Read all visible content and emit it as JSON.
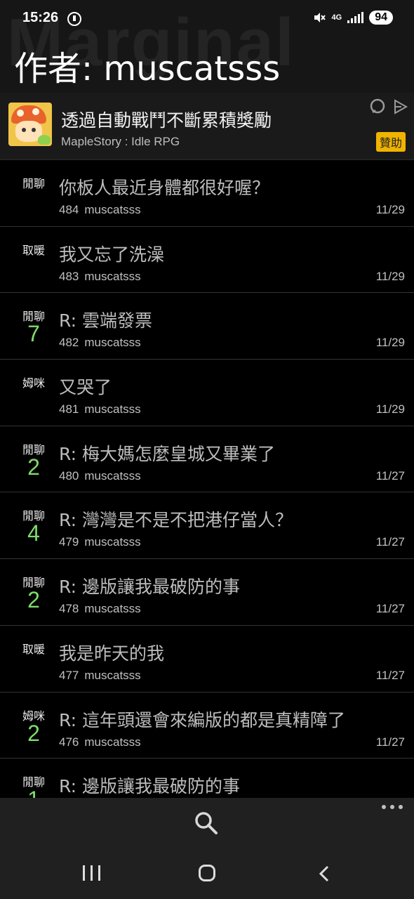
{
  "status_bar": {
    "time": "15:26",
    "network": "4G",
    "battery": "94"
  },
  "header": {
    "watermark": "Marginal",
    "title": "作者: muscatsss"
  },
  "ad": {
    "title": "透過自動戰鬥不斷累積獎勵",
    "subtitle": "MapleStory : Idle RPG",
    "badge": "贊助",
    "icons": [
      "chat-bubble-icon",
      "play-triangle-icon"
    ]
  },
  "posts": [
    {
      "category": "閒聊",
      "reply_count": "",
      "subject": "你板人最近身體都很好喔？",
      "number": "484",
      "author": "muscatsss",
      "date": "11/29"
    },
    {
      "category": "取暖",
      "reply_count": "",
      "subject": "我又忘了洗澡",
      "number": "483",
      "author": "muscatsss",
      "date": "11/29"
    },
    {
      "category": "閒聊",
      "reply_count": "7",
      "subject": "R: 雲端發票",
      "number": "482",
      "author": "muscatsss",
      "date": "11/29"
    },
    {
      "category": "姆咪",
      "reply_count": "",
      "subject": "又哭了",
      "number": "481",
      "author": "muscatsss",
      "date": "11/29"
    },
    {
      "category": "閒聊",
      "reply_count": "2",
      "subject": "R: 梅大媽怎麼皇城又畢業了",
      "number": "480",
      "author": "muscatsss",
      "date": "11/27"
    },
    {
      "category": "閒聊",
      "reply_count": "4",
      "subject": "R: 灣灣是不是不把港仔當人？",
      "number": "479",
      "author": "muscatsss",
      "date": "11/27"
    },
    {
      "category": "閒聊",
      "reply_count": "2",
      "subject": "R: 邊版讓我最破防的事",
      "number": "478",
      "author": "muscatsss",
      "date": "11/27"
    },
    {
      "category": "取暖",
      "reply_count": "",
      "subject": "我是昨天的我",
      "number": "477",
      "author": "muscatsss",
      "date": "11/27"
    },
    {
      "category": "姆咪",
      "reply_count": "2",
      "subject": "R: 這年頭還會來編版的都是真精障了",
      "number": "476",
      "author": "muscatsss",
      "date": "11/27"
    },
    {
      "category": "閒聊",
      "reply_count": "1",
      "subject": "R: 邊版讓我最破防的事",
      "number": "",
      "author": "",
      "date": ""
    }
  ],
  "toolbar": {
    "icons": [
      "search-icon",
      "more-icon"
    ]
  },
  "nav_bar": {
    "icons": [
      "recent-apps-icon",
      "home-icon",
      "back-icon"
    ]
  }
}
